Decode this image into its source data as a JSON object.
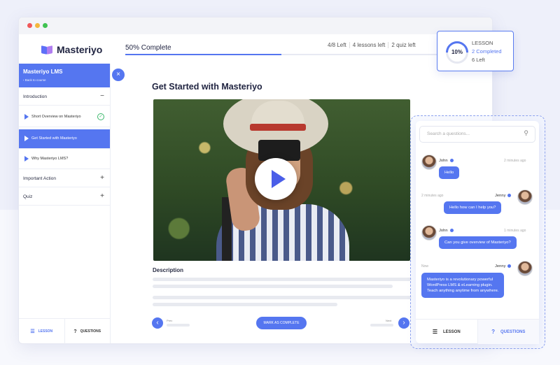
{
  "app": {
    "name": "Masteriyo"
  },
  "progress": {
    "label": "50% Complete",
    "percent": 50
  },
  "stats": [
    "4/8 Left",
    "4 lessons left",
    "2 quiz left"
  ],
  "sidebar": {
    "course_title": "Masteriyo LMS",
    "back_label": "Back to course",
    "close_icon": "×",
    "sections": [
      {
        "title": "Introduction",
        "toggle": "−"
      },
      {
        "title": "Important Action",
        "toggle": "+"
      },
      {
        "title": "Quiz",
        "toggle": "+"
      }
    ],
    "lessons": [
      {
        "label": "Short Overview on Masteriyo",
        "completed": true
      },
      {
        "label": "Get Started with Masteriyo",
        "active": true
      },
      {
        "label": "Why Masteriyo LMS?"
      }
    ],
    "tabs": [
      {
        "label": "LESSON",
        "active": true
      },
      {
        "label": "QUESTIONS"
      }
    ]
  },
  "main": {
    "lesson_title": "Get Started with Masteriyo",
    "description_title": "Description",
    "prev_label": "Prev",
    "next_label": "Next",
    "mark_complete": "MARK AS COMPLETE"
  },
  "lesson_card": {
    "percent_text": "10%",
    "percent": 10,
    "label": "LESSON",
    "completed": "2 Completed",
    "left": "6 Left"
  },
  "chat": {
    "search_placeholder": "Search a questions...",
    "messages": [
      {
        "name": "John",
        "time": "2 minutes ago",
        "text": "Hello",
        "side": "left"
      },
      {
        "name": "Jenny",
        "time": "2 minutes ago",
        "text": "Hello how can I help you?",
        "side": "right"
      },
      {
        "name": "John",
        "time": "1 minutes ago",
        "text": "Can you give overview of Masteriyo?",
        "side": "left"
      },
      {
        "name": "Jenny",
        "time": "Now",
        "text_lines": [
          "Masteriyo is a revolutionary powerful",
          "WordPress LMS & eLearning plugin.",
          "Teach anything anytime from anywhere."
        ],
        "side": "right"
      }
    ],
    "tabs": [
      {
        "label": "LESSON"
      },
      {
        "label": "QUESTIONS",
        "active": true
      }
    ]
  },
  "colors": {
    "accent": "#5576f0",
    "success": "#3bb76b"
  }
}
